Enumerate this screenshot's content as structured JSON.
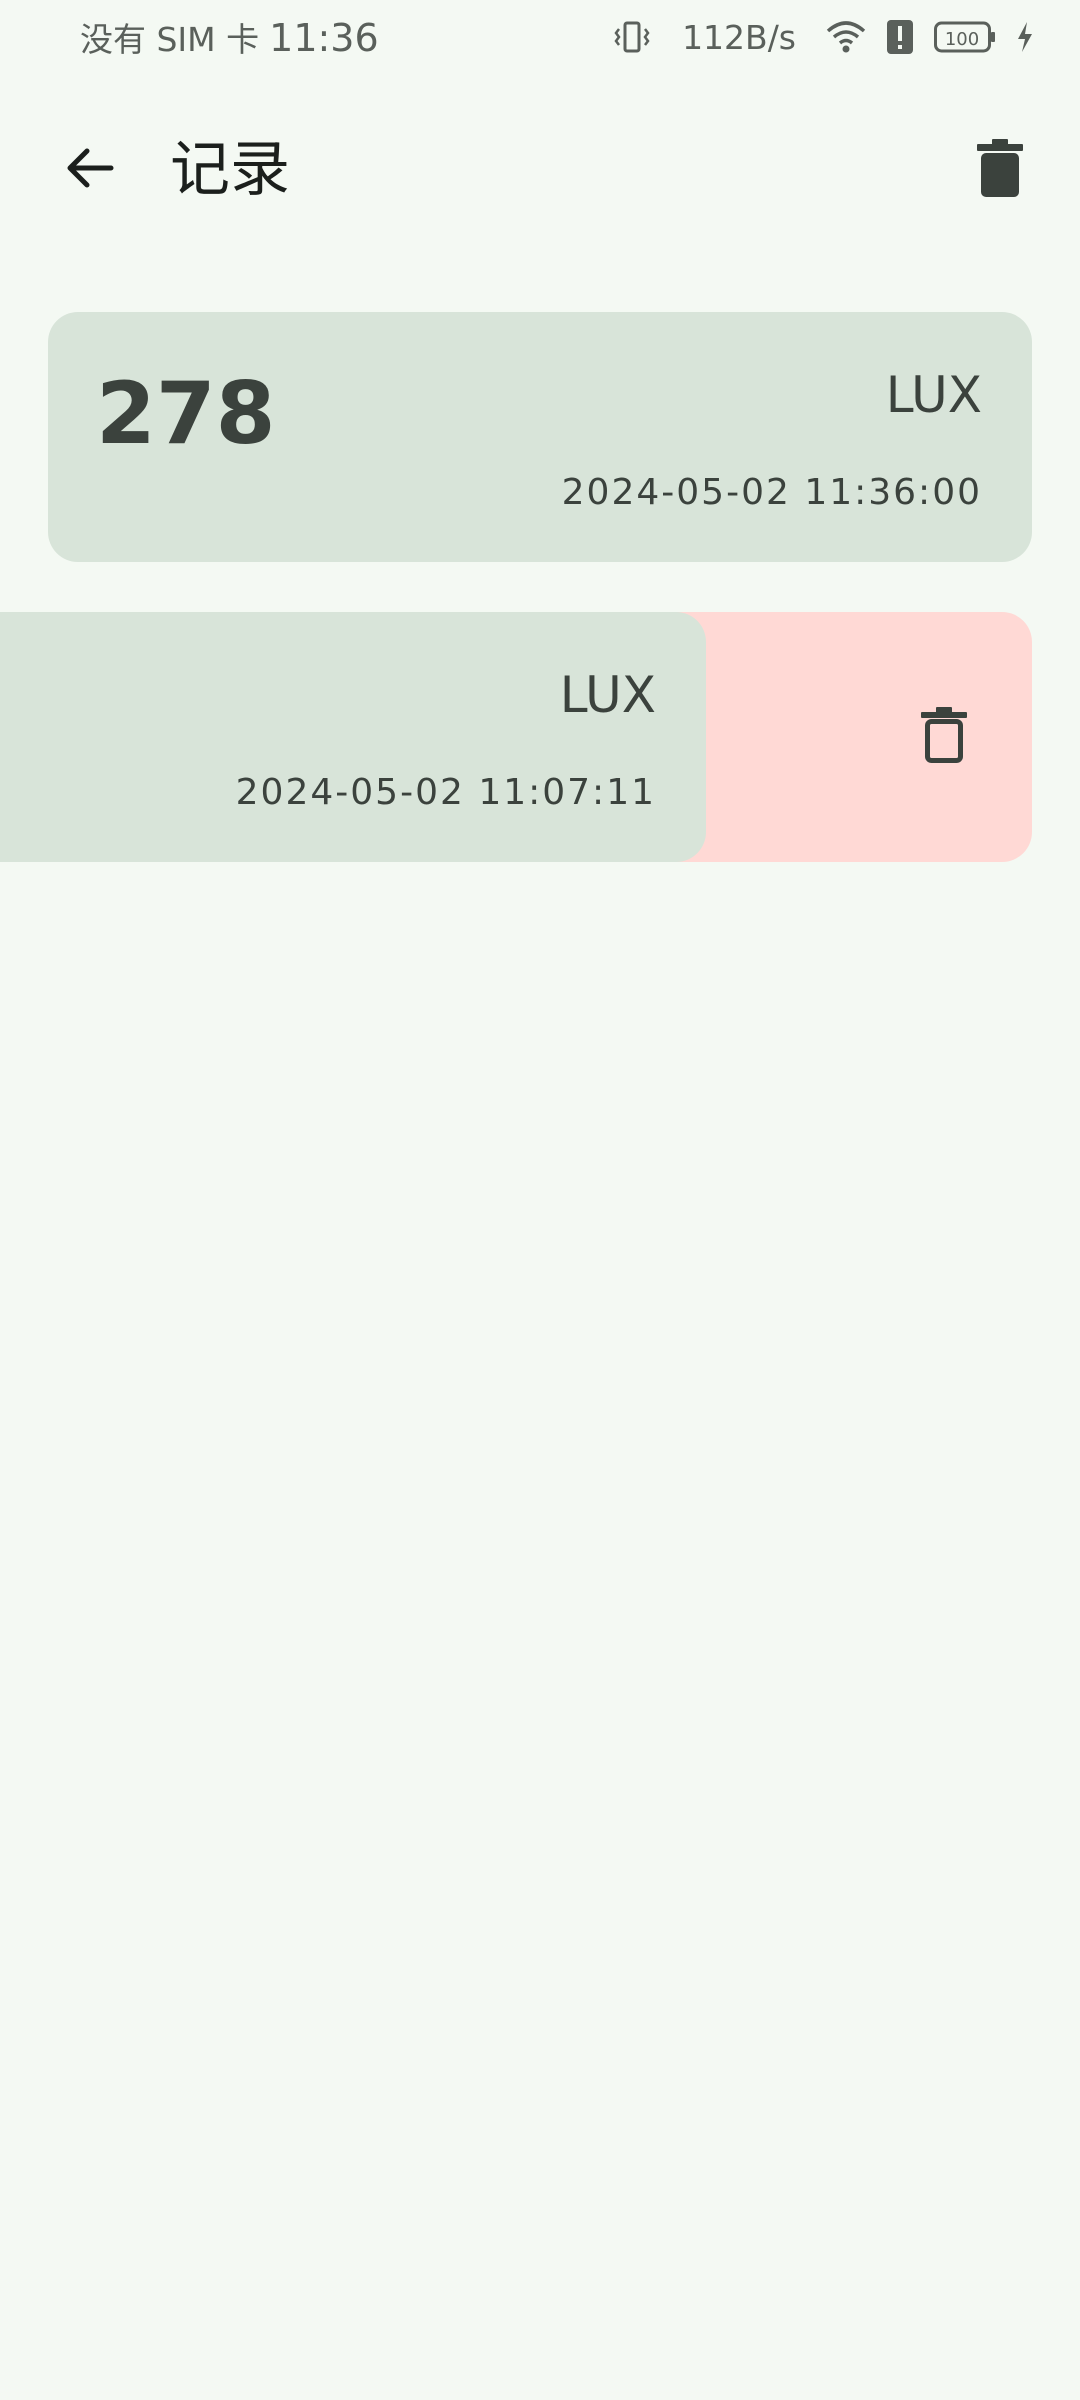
{
  "status_bar": {
    "carrier": "没有 SIM 卡",
    "time": "11:36",
    "net_speed": "112B/s",
    "battery": "100"
  },
  "app_bar": {
    "title": "记录"
  },
  "records": [
    {
      "value": "278",
      "unit": "LUX",
      "timestamp": "2024-05-02 11:36:00"
    },
    {
      "unit": "LUX",
      "timestamp": "2024-05-02 11:07:11"
    }
  ],
  "colors": {
    "background": "#f4f9f3",
    "card": "#d8e4d9",
    "delete_swipe": "#ffd9d5",
    "icon": "#3b423d"
  }
}
